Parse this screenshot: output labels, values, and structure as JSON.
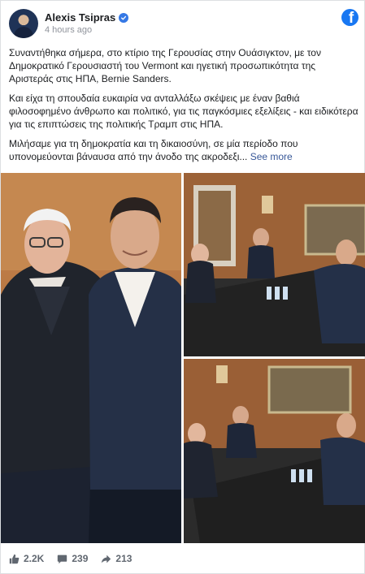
{
  "post": {
    "author": "Alexis Tsipras",
    "timestamp": "4 hours ago",
    "paragraphs": [
      "Συναντήθηκα σήμερα, στο κτίριο της Γερουσίας στην Ουάσιγκτον, με τον Δημοκρατικό Γερουσιαστή του Vermont και ηγετική προσωπικότητα της Αριστεράς στις ΗΠΑ, Bernie Sanders.",
      "Και είχα τη σπουδαία ευκαιρία να ανταλλάξω σκέψεις με έναν βαθιά φιλοσοφημένο άνθρωπο και πολιτικό, για τις παγκόσμιες εξελίξεις - και ειδικότερα για τις επιπτώσεις της πολιτικής Τραμπ στις ΗΠΑ.",
      "Μιλήσαμε για τη δημοκρατία και τη δικαιοσύνη, σε μία περίοδο που υπονομεύονται βάναυσα από την άνοδο της ακροδεξι..."
    ],
    "see_more": "See more"
  },
  "stats": {
    "likes": "2.2K",
    "comments": "239",
    "shares": "213"
  },
  "icons": {
    "verified": "verified-badge-icon",
    "platform": "facebook-logo-icon",
    "like": "thumbs-up-icon",
    "comment": "comment-icon",
    "share": "share-arrow-icon"
  },
  "colors": {
    "facebook_blue": "#1877f2",
    "verified_blue": "#3578e5",
    "link": "#385898",
    "muted": "#90949c"
  }
}
